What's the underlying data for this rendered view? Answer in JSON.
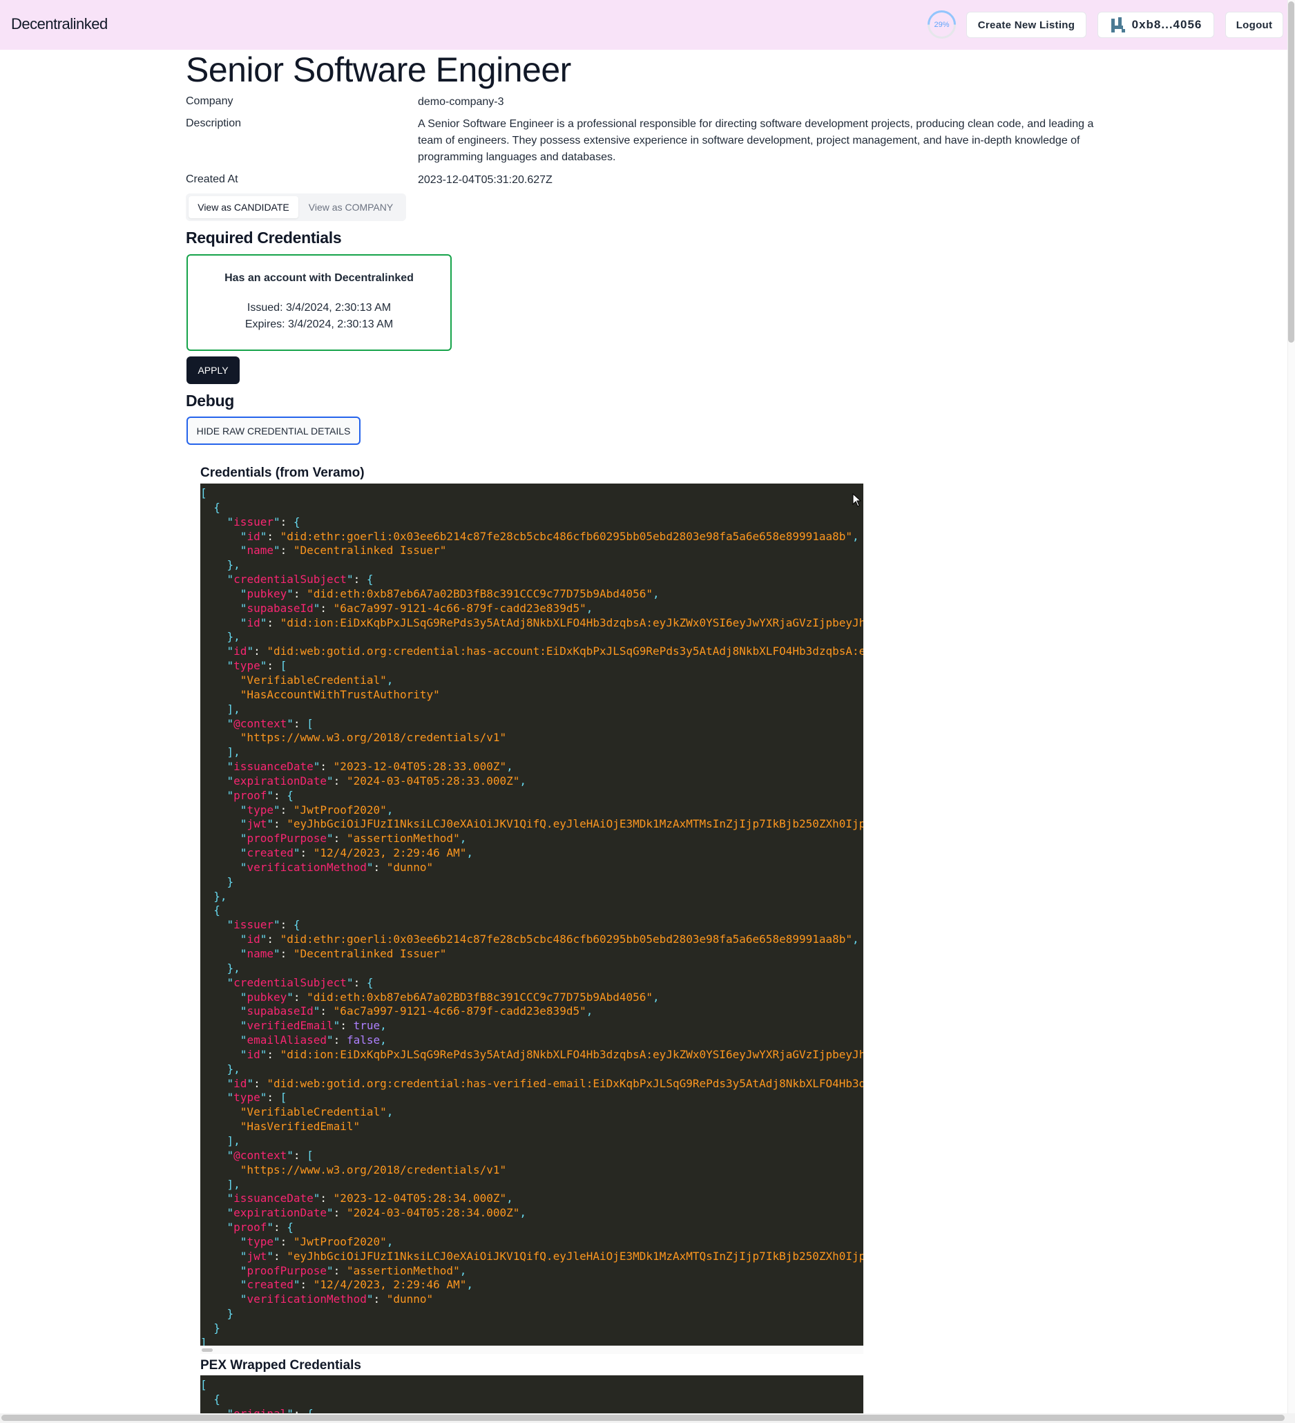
{
  "nav": {
    "brand": "Decentralinked",
    "progress": "29%",
    "create_listing": "Create New Listing",
    "wallet": "0xb8...4056",
    "logout": "Logout"
  },
  "job": {
    "title": "Senior Software Engineer",
    "company_label": "Company",
    "company": "demo-company-3",
    "description_label": "Description",
    "description": "A Senior Software Engineer is a professional responsible for directing software development projects, producing clean code, and leading a team of engineers. They possess extensive experience in software development, project management, and have in-depth knowledge of programming languages and databases.",
    "created_label": "Created At",
    "created": "2023-12-04T05:31:20.627Z"
  },
  "view_toggle": {
    "candidate": "View as CANDIDATE",
    "company": "View as COMPANY",
    "selected": "View as CANDIDATE"
  },
  "required": {
    "heading": "Required Credentials",
    "card_title": "Has an account with Decentralinked",
    "issued": "Issued: 3/4/2024, 2:30:13 AM",
    "expires": "Expires: 3/4/2024, 2:30:13 AM"
  },
  "apply_label": "APPLY",
  "debug": {
    "heading": "Debug",
    "hide_button": "HIDE RAW CREDENTIAL DETAILS",
    "credentials_heading": "Credentials (from Veramo)",
    "pex_heading": "PEX Wrapped Credentials",
    "credentials_json": [
      "[",
      "  {",
      "    \"issuer\": {",
      "      \"id\": \"did:ethr:goerli:0x03ee6b214c87fe28cb5cbc486cfb60295bb05ebd2803e98fa5a6e658e89991aa8b\",",
      "      \"name\": \"Decentralinked Issuer\"",
      "    },",
      "    \"credentialSubject\": {",
      "      \"pubkey\": \"did:eth:0xb87eb6A7a02BD3fB8c391CCC9c77D75b9Abd4056\",",
      "      \"supabaseId\": \"6ac7a997-9121-4c66-879f-cadd23e839d5\",",
      "      \"id\": \"did:ion:EiDxKqbPxJLSqG9RePds3y5AtAdj8NkbXLFO4Hb3dzqbsA:eyJkZWx0YSI6eyJwYXRjaGVzIjpbeyJh",
      "    },",
      "    \"id\": \"did:web:gotid.org:credential:has-account:EiDxKqbPxJLSqG9RePds3y5AtAdj8NkbXLFO4Hb3dzqbsA:e",
      "    \"type\": [",
      "      \"VerifiableCredential\",",
      "      \"HasAccountWithTrustAuthority\"",
      "    ],",
      "    \"@context\": [",
      "      \"https://www.w3.org/2018/credentials/v1\"",
      "    ],",
      "    \"issuanceDate\": \"2023-12-04T05:28:33.000Z\",",
      "    \"expirationDate\": \"2024-03-04T05:28:33.000Z\",",
      "    \"proof\": {",
      "      \"type\": \"JwtProof2020\",",
      "      \"jwt\": \"eyJhbGciOiJFUzI1NksiLCJ0eXAiOiJKV1QifQ.eyJleHAiOjE3MDk1MzAxMTMsInZjIjp7IkBjb250ZXh0Ijp",
      "      \"proofPurpose\": \"assertionMethod\",",
      "      \"created\": \"12/4/2023, 2:29:46 AM\",",
      "      \"verificationMethod\": \"dunno\"",
      "    }",
      "  },",
      "  {",
      "    \"issuer\": {",
      "      \"id\": \"did:ethr:goerli:0x03ee6b214c87fe28cb5cbc486cfb60295bb05ebd2803e98fa5a6e658e89991aa8b\",",
      "      \"name\": \"Decentralinked Issuer\"",
      "    },",
      "    \"credentialSubject\": {",
      "      \"pubkey\": \"did:eth:0xb87eb6A7a02BD3fB8c391CCC9c77D75b9Abd4056\",",
      "      \"supabaseId\": \"6ac7a997-9121-4c66-879f-cadd23e839d5\",",
      "      \"verifiedEmail\": true,",
      "      \"emailAliased\": false,",
      "      \"id\": \"did:ion:EiDxKqbPxJLSqG9RePds3y5AtAdj8NkbXLFO4Hb3dzqbsA:eyJkZWx0YSI6eyJwYXRjaGVzIjpbeyJh",
      "    },",
      "    \"id\": \"did:web:gotid.org:credential:has-verified-email:EiDxKqbPxJLSqG9RePds3y5AtAdj8NkbXLFO4Hb3d",
      "    \"type\": [",
      "      \"VerifiableCredential\",",
      "      \"HasVerifiedEmail\"",
      "    ],",
      "    \"@context\": [",
      "      \"https://www.w3.org/2018/credentials/v1\"",
      "    ],",
      "    \"issuanceDate\": \"2023-12-04T05:28:34.000Z\",",
      "    \"expirationDate\": \"2024-03-04T05:28:34.000Z\",",
      "    \"proof\": {",
      "      \"type\": \"JwtProof2020\",",
      "      \"jwt\": \"eyJhbGciOiJFUzI1NksiLCJ0eXAiOiJKV1QifQ.eyJleHAiOjE3MDk1MzAxMTQsInZjIjp7IkBjb250ZXh0Ijp",
      "      \"proofPurpose\": \"assertionMethod\",",
      "      \"created\": \"12/4/2023, 2:29:46 AM\",",
      "      \"verificationMethod\": \"dunno\"",
      "    }",
      "  }",
      "]"
    ],
    "pex_json": [
      "[",
      "  {",
      "    \"original\": {"
    ]
  },
  "colors": {
    "topbar": "#f8e3f8",
    "code_bg": "#272822",
    "key": "#f92672",
    "string": "#fd971f",
    "punct": "#66d9ef",
    "bool": "#ae81ff",
    "card_border": "#16a34a",
    "focus": "#2563eb"
  },
  "icons": [
    "wallet-avatar-icon",
    "cursor-icon"
  ]
}
